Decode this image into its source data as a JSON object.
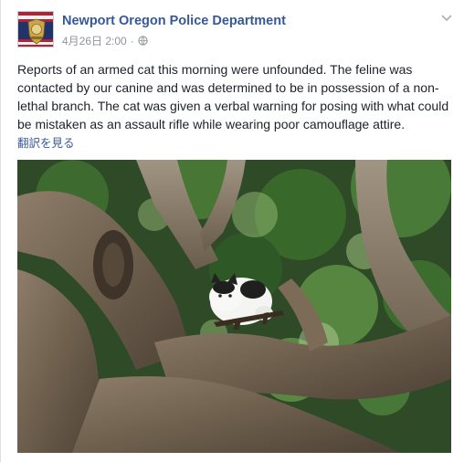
{
  "post": {
    "author": "Newport Oregon Police Department",
    "date": "4月26日 2:00",
    "separator": "·",
    "privacy_icon": "globe-icon",
    "menu_icon": "chevron-down-icon",
    "body": "Reports of an armed cat this morning were unfounded. The feline was contacted by our canine and was determined to be in possession of a non-lethal branch. The cat was given a verbal warning for posing with what could be mistaken as an assault rifle while wearing poor camouflage attire.",
    "translate_link": "翻訳を見る"
  },
  "photo": {
    "subject": "cat-in-tree-photo"
  },
  "colors": {
    "link": "#365899",
    "meta": "#90949c",
    "text": "#1d2129"
  }
}
